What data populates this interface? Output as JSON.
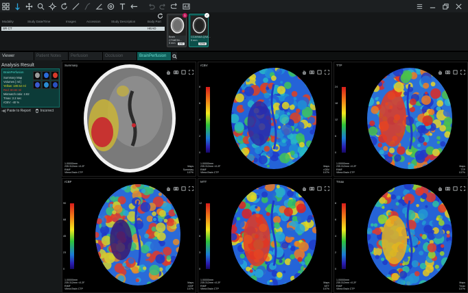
{
  "toolbar": {
    "icons": [
      "pointer-icon",
      "pan-icon",
      "zoom-icon",
      "crosshair-icon",
      "rotate-icon",
      "line-icon",
      "curve-icon",
      "angle-icon",
      "roi-icon",
      "text-icon",
      "back-arrow-icon",
      "undo-icon",
      "redo-icon",
      "save-icon",
      "capture-icon"
    ],
    "window": [
      "menu-icon",
      "minimize-icon",
      "restore-icon",
      "close-icon"
    ]
  },
  "study": {
    "headers": [
      "Modality",
      "Study Date/Time",
      "Images",
      "Accession",
      "Study Description",
      "Body Part"
    ],
    "row": {
      "modality": "SR CT",
      "body_part": "HEAD"
    },
    "series": [
      {
        "desc": "Brain CT/MEIN...",
        "sub": "5 mm",
        "count": "192",
        "badge": "1"
      },
      {
        "desc": "CCA/NA/LQSA...",
        "sub": "5 mm",
        "count": "3206",
        "badge": "✓"
      }
    ]
  },
  "tabs": [
    "Viewer",
    "Patient Notes",
    "Perfusion",
    "Occlusion",
    "BrainPerfusion"
  ],
  "left": {
    "title": "Analysis Result",
    "card_title": "BrainPerfusion",
    "lines": [
      {
        "text": "Summary Map",
        "color": ""
      },
      {
        "text": "Volumes [ ml ]",
        "color": ""
      },
      {
        "text": "Yellow: 100.52 ml",
        "color": "yellow"
      },
      {
        "text": "Red: 80.84 ml",
        "color": "red"
      },
      {
        "text": "Mismatch ratio: 2.82",
        "color": ""
      },
      {
        "text": "Tmax: 2.2 sec",
        "color": ""
      },
      {
        "text": "rCBV: -40 %",
        "color": ""
      }
    ],
    "paste_label": "Paste to Report",
    "incorrect_label": "Incorrect"
  },
  "viewports": [
    {
      "label": "Summary",
      "scale": [],
      "info": [
        "1.00000mm",
        "235.312mm <0.2F",
        "RIMF",
        "Vitrea Brain CTP"
      ],
      "map": [
        "Maps",
        "Summary",
        "107%"
      ]
    },
    {
      "label": "rCBV",
      "scale": [
        "8",
        "6",
        "4",
        "2",
        "0"
      ],
      "info": [
        "1.00000mm",
        "235.312mm <0.2F",
        "RIMF",
        "Vitrea Brain CTP"
      ],
      "map": [
        "Maps",
        "rCBV",
        "107%"
      ]
    },
    {
      "label": "TTP",
      "scale": [
        "24",
        "18",
        "12",
        "6",
        "0"
      ],
      "info": [
        "1.00000mm",
        "235.312mm <0.2F",
        "RIMF",
        "Vitrea Brain CTP"
      ],
      "map": [
        "Maps",
        "TTP",
        "107%"
      ]
    },
    {
      "label": "rCBF",
      "scale": [
        "90",
        "68",
        "45",
        "23",
        "0"
      ],
      "info": [
        "1.00000mm",
        "235.312mm <0.2F",
        "RIMF",
        "Vitrea Brain CTP"
      ],
      "map": [
        "Maps",
        "rCBF",
        "107%"
      ]
    },
    {
      "label": "MTT",
      "scale": [
        "12",
        "9",
        "6",
        "3",
        "0"
      ],
      "info": [
        "1.00000mm",
        "235.312mm <0.2F",
        "RIMF",
        "Vitrea Brain CTP"
      ],
      "map": [
        "Maps",
        "MTT",
        "107%"
      ]
    },
    {
      "label": "Tmax",
      "scale": [
        "8",
        "6",
        "4",
        "2",
        "0"
      ],
      "info": [
        "1.00000mm",
        "235.312mm <0.2F",
        "RIMF",
        "Vitrea Brain CTP"
      ],
      "map": [
        "Maps",
        "Tmax",
        "107%"
      ]
    }
  ],
  "colors": {
    "accent": "#2ba7df",
    "teal": "#0e5f5a",
    "yellow": "#e6de22",
    "red": "#e5392c"
  }
}
